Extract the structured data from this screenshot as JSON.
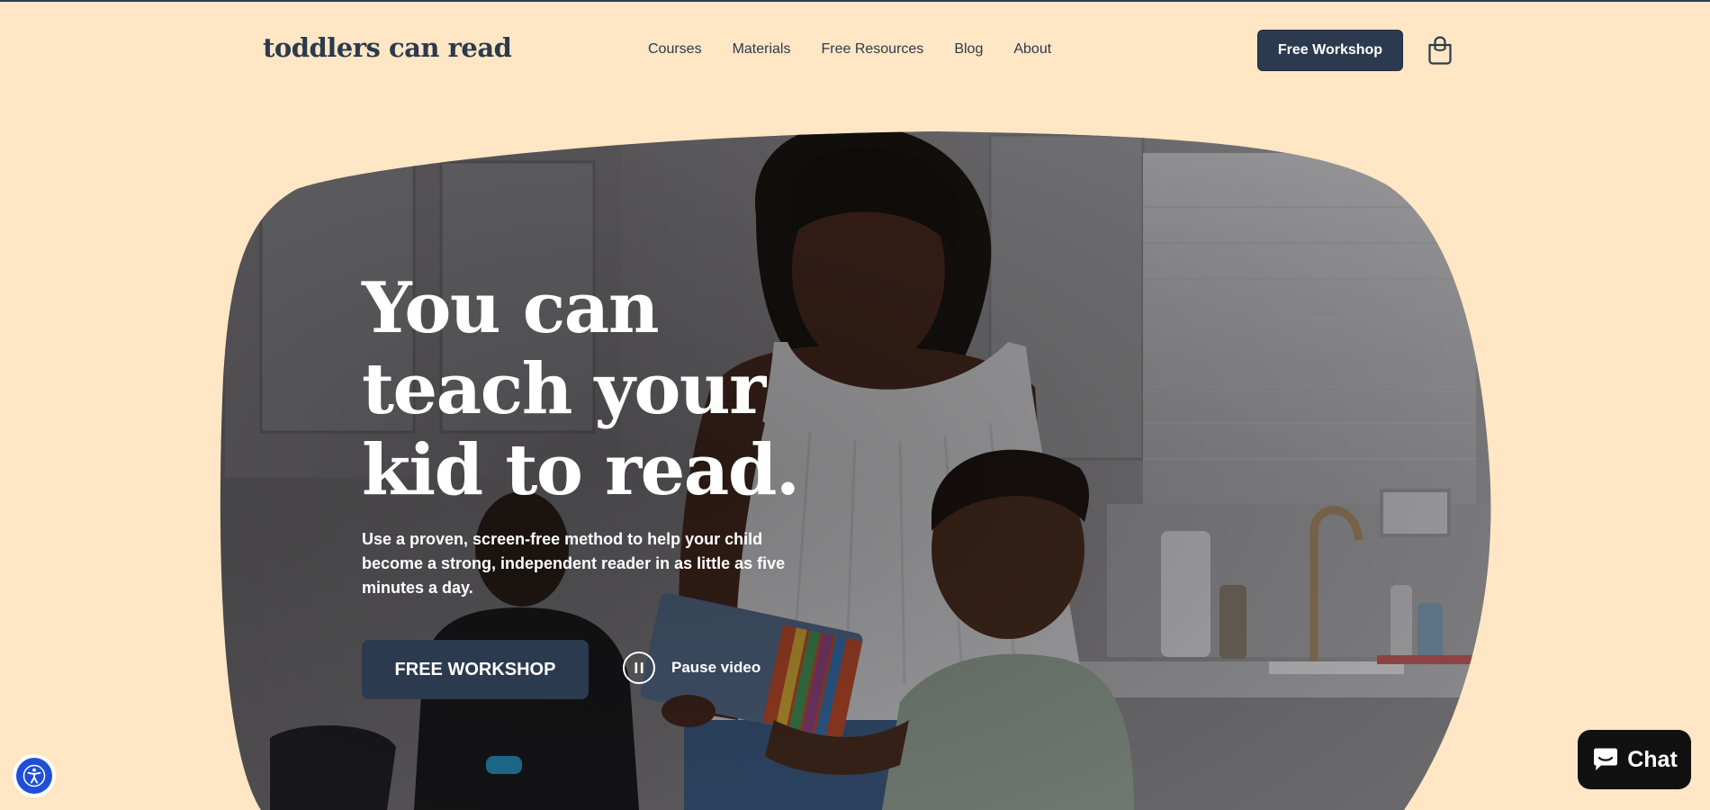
{
  "header": {
    "logo": "toddlers can read",
    "nav": [
      "Courses",
      "Materials",
      "Free Resources",
      "Blog",
      "About"
    ],
    "cta_label": "Free Workshop",
    "cart_icon": "shopping-bag-icon"
  },
  "hero": {
    "title_lines": [
      "You can",
      "teach your",
      "kid to read."
    ],
    "subtitle": "Use a proven, screen-free method to help your child become a strong, independent reader in as little as five minutes a day.",
    "cta_label": "FREE WORKSHOP",
    "video_control_label": "Pause video",
    "video_control_icon": "pause-icon",
    "background_image": "mother-and-toddlers-kitchen-photo"
  },
  "widgets": {
    "accessibility_icon": "accessibility-icon",
    "chat_label": "Chat",
    "chat_icon": "chat-bubble-icon"
  },
  "colors": {
    "page_background": "#ffe6c5",
    "brand_navy": "#2c3a4f",
    "accessibility_blue": "#1f4fd6",
    "chat_black": "#111111"
  }
}
